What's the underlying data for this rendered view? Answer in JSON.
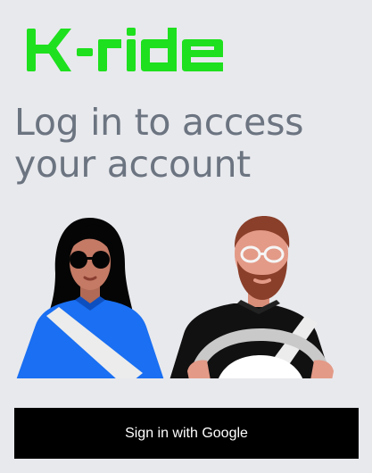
{
  "brand": {
    "logo_text": "K-ride",
    "logo_color": "#1ee01e"
  },
  "headline": "Log in to access your account",
  "illustration": {
    "figures": [
      "woman-passenger",
      "man-driver"
    ]
  },
  "signin_button": {
    "label": "Sign in with Google",
    "background": "#000000",
    "text_color": "#ffffff"
  },
  "colors": {
    "background": "#e8e9ed",
    "headline": "#6b7480",
    "passenger_shirt": "#1a6ff2",
    "driver_shirt": "#111111",
    "steering_wheel": "#c9c9c9"
  }
}
